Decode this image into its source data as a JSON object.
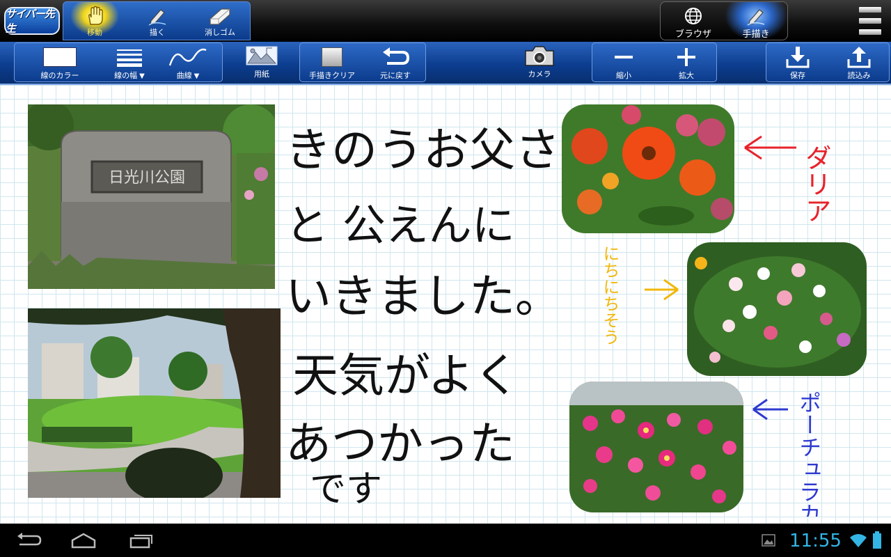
{
  "app": {
    "logo_text": "サイバー先生"
  },
  "modes": [
    {
      "label": "移動",
      "icon": "hand-icon",
      "active": true
    },
    {
      "label": "描く",
      "icon": "pen-icon",
      "active": false
    },
    {
      "label": "消しゴム",
      "icon": "eraser-icon",
      "active": false
    }
  ],
  "right_modes": [
    {
      "label": "ブラウザ",
      "icon": "globe-icon",
      "active": false
    },
    {
      "label": "手描き",
      "icon": "pen-icon",
      "active": true
    }
  ],
  "toolbar": {
    "line_color": "線のカラー",
    "line_width": "線の幅",
    "curve": "曲線",
    "dropdown_mark": "▼",
    "paper": "用紙",
    "clear_handwriting": "手描きクリア",
    "undo": "元に戻す",
    "camera": "カメラ",
    "zoom_out": "縮小",
    "zoom_in": "拡大",
    "save": "保存",
    "load": "読込み"
  },
  "canvas": {
    "sign_text": "日光川公園",
    "note_lines": [
      "きのうお父さん",
      "と 公えんに",
      "いきました。",
      "天気がよく",
      "あつかった",
      "です"
    ],
    "flowers": [
      {
        "name": "ダリア",
        "color": "#e8222b"
      },
      {
        "name": "にちにちそう",
        "color": "#f2b70c"
      },
      {
        "name": "ポーチュラカ",
        "color": "#2e3ad0"
      }
    ],
    "ink_color": "#111111"
  },
  "status": {
    "time": "11:55",
    "accent": "#33b5e5"
  }
}
